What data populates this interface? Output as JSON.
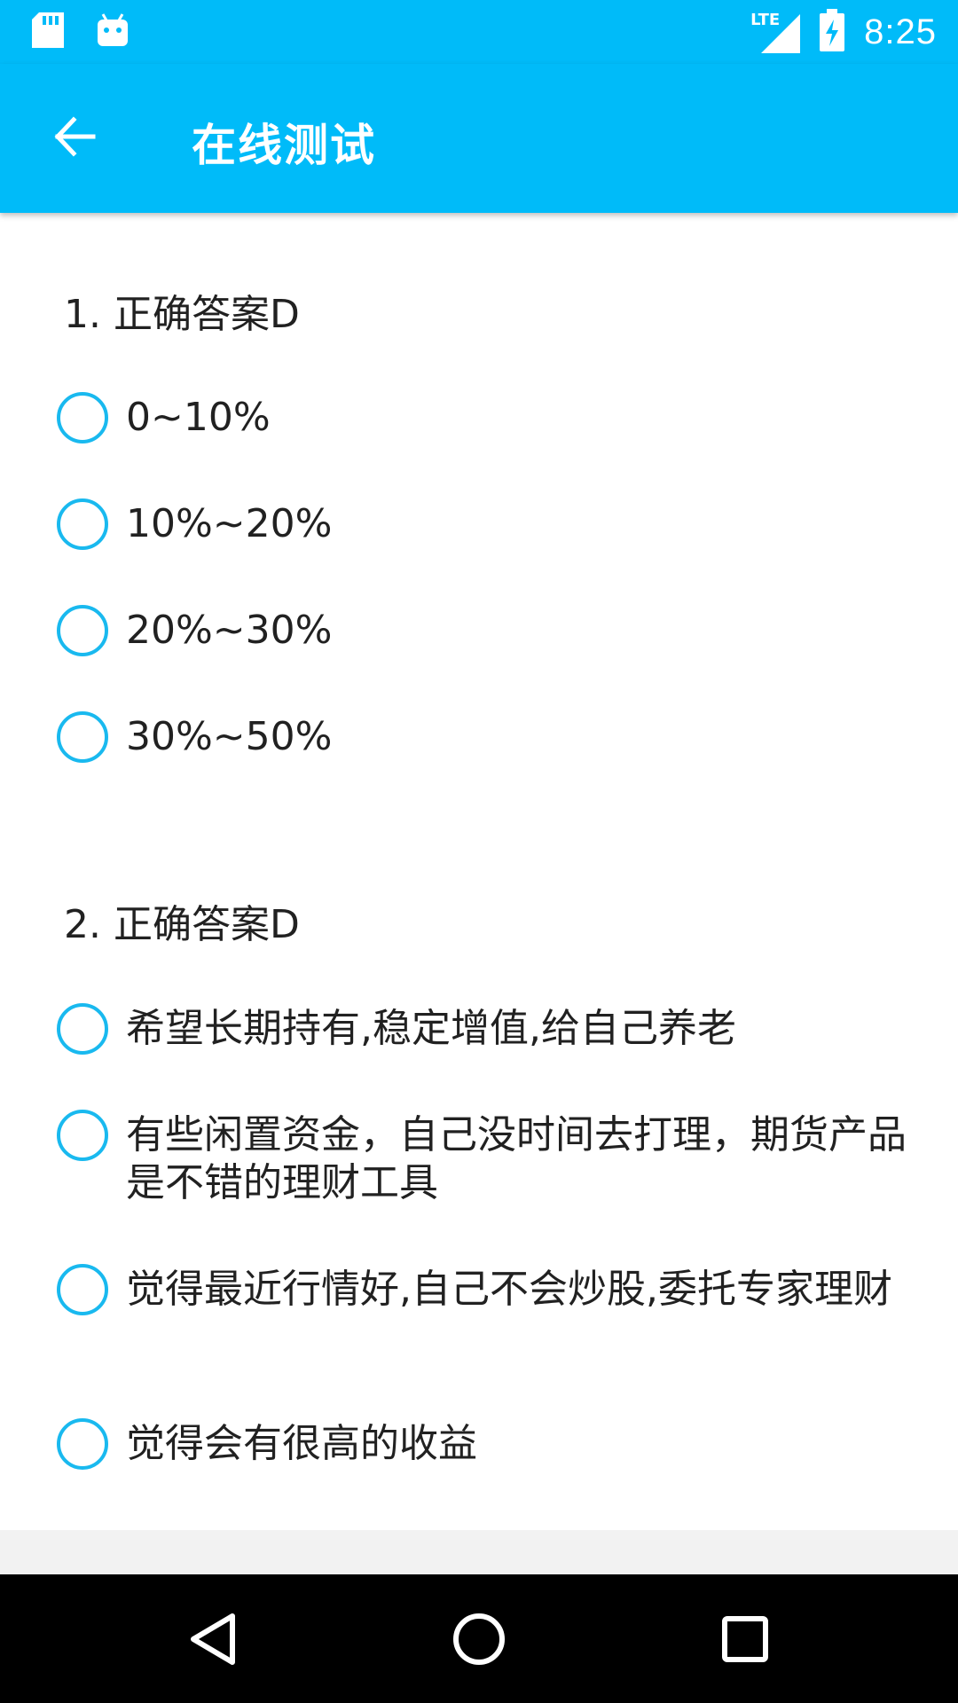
{
  "status_bar": {
    "time": "8:25",
    "network": "LTE",
    "icons": [
      "sd-card-icon",
      "android-icon",
      "signal-icon",
      "battery-charging-icon"
    ]
  },
  "app_bar": {
    "title": "在线测试",
    "back_icon": "arrow-back-icon"
  },
  "questions": [
    {
      "title": "1. 正确答案D",
      "options": [
        "0~10%",
        "10%~20%",
        "20%~30%",
        "30%~50%"
      ]
    },
    {
      "title": "2. 正确答案D",
      "options": [
        "希望长期持有,稳定增值,给自己养老",
        "有些闲置资金，自己没时间去打理，期货产品是不错的理财工具",
        "觉得最近行情好,自己不会炒股,委托专家理财",
        "觉得会有很高的收益"
      ]
    }
  ],
  "nav_bar": {
    "icons": [
      "back-triangle-icon",
      "home-circle-icon",
      "recents-square-icon"
    ]
  },
  "colors": {
    "primary": "#00bbf9",
    "radio": "#19b9ef",
    "text": "#212121"
  }
}
